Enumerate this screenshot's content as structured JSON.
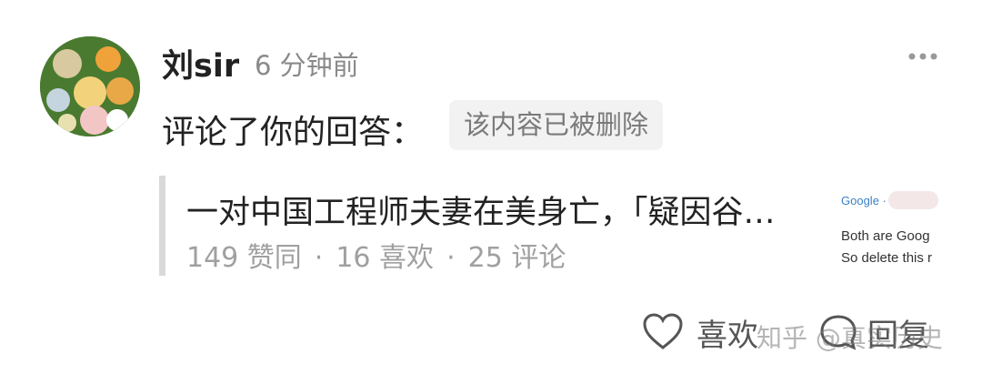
{
  "comment": {
    "username": "刘sir",
    "time": "6 分钟前",
    "action": "评论了你的回答：",
    "deleted_notice": "该内容已被删除"
  },
  "quote": {
    "title": "一对中国工程师夫妻在美身亡，「疑因谷…",
    "likes": "149 赞同",
    "favorites": "16 喜欢",
    "comments": "25 评论",
    "separator": "·"
  },
  "thumbnail": {
    "google_label": "Google ·",
    "line1": "Both are Goog",
    "line2": "So delete this r"
  },
  "actions": {
    "like_label": "喜欢",
    "reply_label": "回复"
  },
  "watermark": "知乎 @真实历史",
  "icons": {
    "more": "more-dots-icon",
    "like": "heart-icon",
    "reply": "comment-bubble-icon"
  }
}
